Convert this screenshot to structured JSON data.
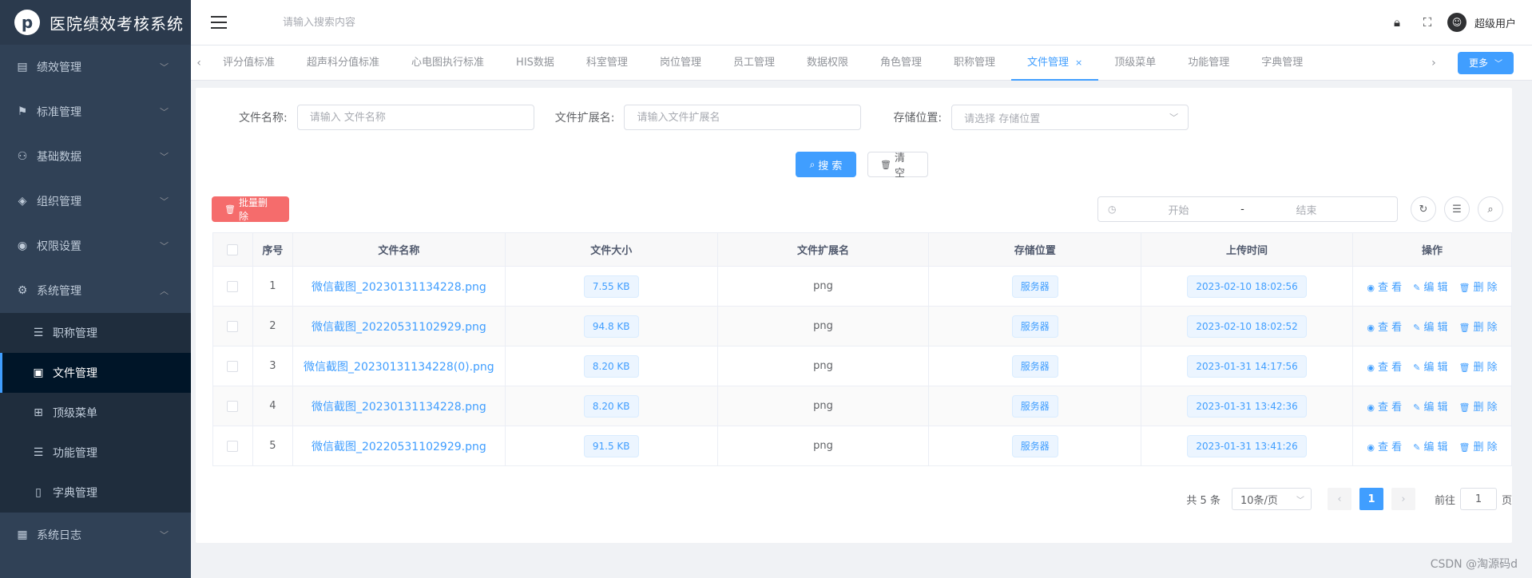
{
  "app": {
    "title": "医院绩效考核系统",
    "logo_glyph": "p"
  },
  "sidebar": {
    "items": [
      {
        "label": "绩效管理",
        "icon": "document-icon",
        "glyph": "▤"
      },
      {
        "label": "标准管理",
        "icon": "flag-icon",
        "glyph": "⚑"
      },
      {
        "label": "基础数据",
        "icon": "user-icon",
        "glyph": "⚇"
      },
      {
        "label": "组织管理",
        "icon": "tag-icon",
        "glyph": "◈"
      },
      {
        "label": "权限设置",
        "icon": "shield-icon",
        "glyph": "◉"
      },
      {
        "label": "系统管理",
        "icon": "gear-icon",
        "glyph": "⚙"
      }
    ],
    "sub_items": [
      {
        "label": "职称管理",
        "icon": "list-icon",
        "glyph": "☰"
      },
      {
        "label": "文件管理",
        "icon": "file-icon",
        "glyph": "▣"
      },
      {
        "label": "顶级菜单",
        "icon": "tree-icon",
        "glyph": "⊞"
      },
      {
        "label": "功能管理",
        "icon": "list-icon",
        "glyph": "☰"
      },
      {
        "label": "字典管理",
        "icon": "book-icon",
        "glyph": "▯"
      }
    ],
    "log_item": {
      "label": "系统日志",
      "icon": "log-icon",
      "glyph": "▦"
    }
  },
  "header": {
    "search_placeholder": "请输入搜索内容",
    "user_name": "超级用户"
  },
  "tabs": {
    "items": [
      "评分值标准",
      "超声科分值标准",
      "心电图执行标准",
      "HIS数据",
      "科室管理",
      "岗位管理",
      "员工管理",
      "数据权限",
      "角色管理",
      "职称管理",
      "文件管理",
      "顶级菜单",
      "功能管理",
      "字典管理"
    ],
    "active_index": 10,
    "close_glyph": "×",
    "more_label": "更多"
  },
  "filters": {
    "name_label": "文件名称:",
    "name_placeholder": "请输入 文件名称",
    "ext_label": "文件扩展名:",
    "ext_placeholder": "请输入文件扩展名",
    "storage_label": "存储位置:",
    "storage_placeholder": "请选择 存储位置",
    "search_label": "搜 索",
    "clear_label": "清 空"
  },
  "toolbar": {
    "batch_delete_label": "批量删除",
    "date_start_placeholder": "开始",
    "date_separator": "-",
    "date_end_placeholder": "结束"
  },
  "table": {
    "headers": [
      "序号",
      "文件名称",
      "文件大小",
      "文件扩展名",
      "存储位置",
      "上传时间",
      "操作"
    ],
    "rows": [
      {
        "index": "1",
        "name": "微信截图_20230131134228.png",
        "size": "7.55 KB",
        "ext": "png",
        "storage": "服务器",
        "time": "2023-02-10 18:02:56"
      },
      {
        "index": "2",
        "name": "微信截图_20220531102929.png",
        "size": "94.8 KB",
        "ext": "png",
        "storage": "服务器",
        "time": "2023-02-10 18:02:52"
      },
      {
        "index": "3",
        "name": "微信截图_20230131134228(0).png",
        "size": "8.20 KB",
        "ext": "png",
        "storage": "服务器",
        "time": "2023-01-31 14:17:56"
      },
      {
        "index": "4",
        "name": "微信截图_20230131134228.png",
        "size": "8.20 KB",
        "ext": "png",
        "storage": "服务器",
        "time": "2023-01-31 13:42:36"
      },
      {
        "index": "5",
        "name": "微信截图_20220531102929.png",
        "size": "91.5 KB",
        "ext": "png",
        "storage": "服务器",
        "time": "2023-01-31 13:41:26"
      }
    ],
    "actions": {
      "view": "查 看",
      "edit": "编 辑",
      "delete": "删 除"
    }
  },
  "pagination": {
    "total_text": "共 5 条",
    "page_size": "10条/页",
    "current_page": "1",
    "goto_label": "前往",
    "goto_value": "1",
    "page_suffix": "页"
  },
  "watermark": "CSDN @淘源码d",
  "colors": {
    "primary": "#409eff",
    "danger": "#f56c6c",
    "sidebar": "#304156"
  }
}
